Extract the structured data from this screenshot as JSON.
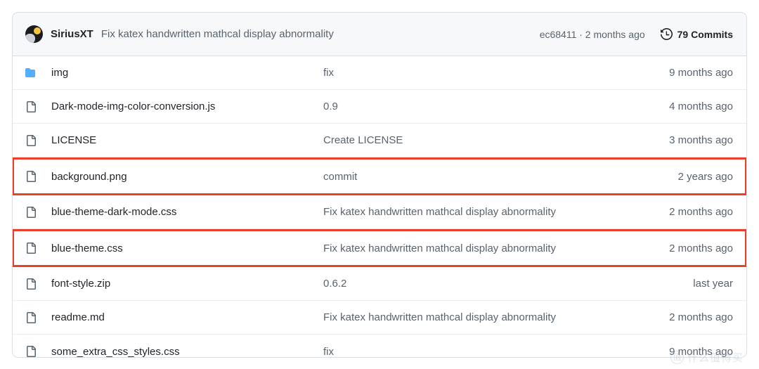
{
  "header": {
    "avatar_name": "user-avatar",
    "author": "SiriusXT",
    "commit_message": "Fix katex handwritten mathcal display abnormality",
    "sha_and_time": "ec68411 · 2 months ago",
    "commits_label": "79 Commits",
    "history_icon": "history-clock-icon"
  },
  "colors": {
    "highlight_border": "#e8402a",
    "folder_icon": "#54aeff",
    "header_bg": "#f6f8fa",
    "border": "#d8dee4",
    "muted_text": "#59636e",
    "primary_text": "#1f2328"
  },
  "files": [
    {
      "icon": "folder-icon",
      "type": "folder",
      "name": "img",
      "message": "fix",
      "time": "9 months ago",
      "highlighted": false
    },
    {
      "icon": "file-icon",
      "type": "file",
      "name": "Dark-mode-img-color-conversion.js",
      "message": "0.9",
      "time": "4 months ago",
      "highlighted": false
    },
    {
      "icon": "file-icon",
      "type": "file",
      "name": "LICENSE",
      "message": "Create LICENSE",
      "time": "3 months ago",
      "highlighted": false
    },
    {
      "icon": "file-icon",
      "type": "file",
      "name": "background.png",
      "message": "commit",
      "time": "2 years ago",
      "highlighted": true
    },
    {
      "icon": "file-icon",
      "type": "file",
      "name": "blue-theme-dark-mode.css",
      "message": "Fix katex handwritten mathcal display abnormality",
      "time": "2 months ago",
      "highlighted": false
    },
    {
      "icon": "file-icon",
      "type": "file",
      "name": "blue-theme.css",
      "message": "Fix katex handwritten mathcal display abnormality",
      "time": "2 months ago",
      "highlighted": true
    },
    {
      "icon": "file-icon",
      "type": "file",
      "name": "font-style.zip",
      "message": "0.6.2",
      "time": "last year",
      "highlighted": false
    },
    {
      "icon": "file-icon",
      "type": "file",
      "name": "readme.md",
      "message": "Fix katex handwritten mathcal display abnormality",
      "time": "2 months ago",
      "highlighted": false
    },
    {
      "icon": "file-icon",
      "type": "file",
      "name": "some_extra_css_styles.css",
      "message": "fix",
      "time": "9 months ago",
      "highlighted": false
    }
  ],
  "watermark": {
    "badge": "值",
    "text": "什么值得买"
  }
}
